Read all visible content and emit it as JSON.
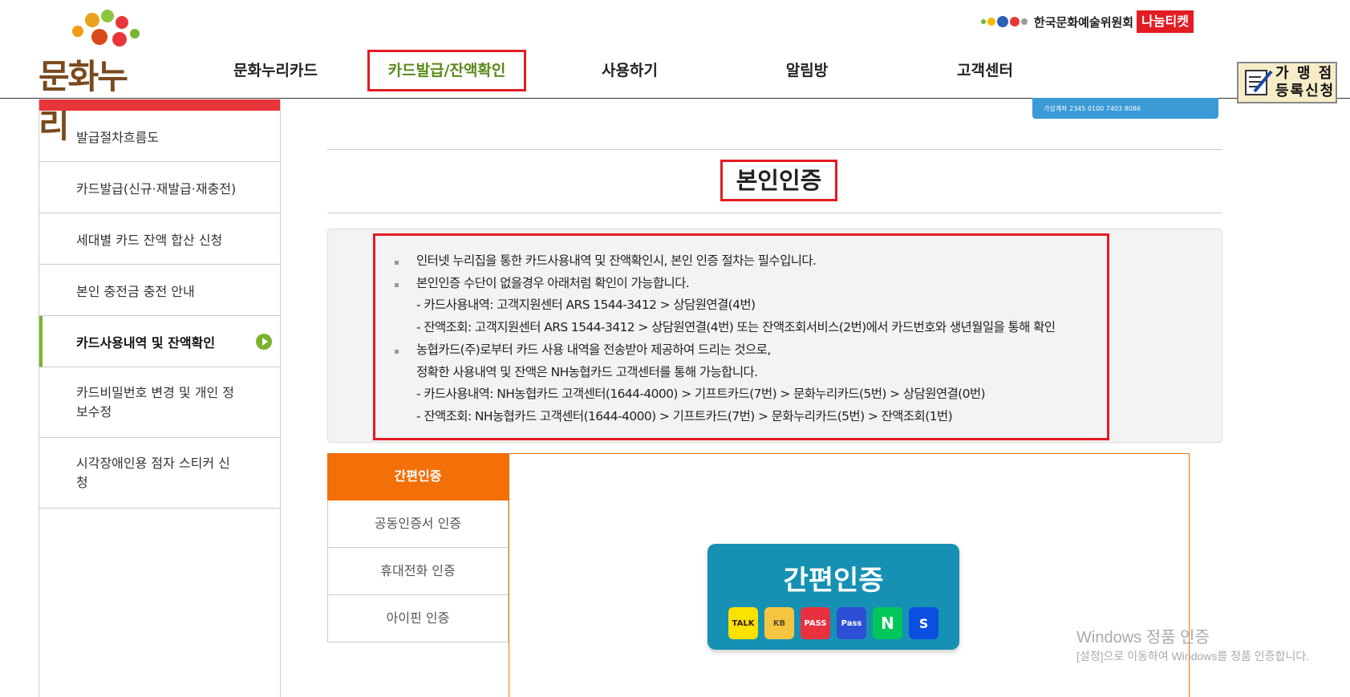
{
  "header": {
    "logo_text": "문화누리",
    "nav": [
      {
        "label": "문화누리카드",
        "active": false
      },
      {
        "label": "카드발급/잔액확인",
        "active": true
      },
      {
        "label": "사용하기",
        "active": false
      },
      {
        "label": "알림방",
        "active": false
      },
      {
        "label": "고객센터",
        "active": false
      }
    ],
    "arko_label": "한국문화예술위원회",
    "nanum_label": "나눔티켓",
    "store_button": {
      "line1": "가 맹 점",
      "line2": "등록신청"
    },
    "banner_text": "가상계좌 2345 0100 7403 8086"
  },
  "sidebar": {
    "items": [
      {
        "label": "발급절차흐름도",
        "active": false
      },
      {
        "label": "카드발급(신규·재발급·재충전)",
        "active": false
      },
      {
        "label": "세대별 카드 잔액 합산 신청",
        "active": false
      },
      {
        "label": "본인 충전금 충전 안내",
        "active": false
      },
      {
        "label": "카드사용내역 및 잔액확인",
        "active": true
      },
      {
        "label": "카드비밀번호 변경 및 개인 정보수정",
        "active": false
      },
      {
        "label": "시각장애인용 점자 스티커 신청",
        "active": false
      }
    ]
  },
  "main": {
    "title": "본인인증",
    "notice": [
      {
        "text": "인터넷 누리집을 통한 카드사용내역 및 잔액확인시, 본인 인증 절차는 필수입니다.",
        "bullet": true
      },
      {
        "text": "본인인증 수단이 없을경우 아래처럼 확인이 가능합니다.",
        "bullet": true
      },
      {
        "text": "- 카드사용내역: 고객지원센터 ARS 1544-3412 > 상담원연결(4번)",
        "bullet": false
      },
      {
        "text": "- 잔액조회: 고객지원센터 ARS 1544-3412 > 상담원연결(4번) 또는 잔액조회서비스(2번)에서 카드번호와 생년월일을 통해 확인",
        "bullet": false
      },
      {
        "text": "농협카드(주)로부터 카드 사용 내역을 전송받아 제공하여 드리는 것으로,",
        "bullet": true
      },
      {
        "text": "정확한 사용내역 및 잔액은 NH농협카드 고객센터를 통해 가능합니다.",
        "bullet": false
      },
      {
        "text": "- 카드사용내역: NH농협카드 고객센터(1644-4000) > 기프트카드(7번) > 문화누리카드(5번) > 상담원연결(0번)",
        "bullet": false
      },
      {
        "text": "- 잔액조회: NH농협카드 고객센터(1644-4000) > 기프트카드(7번) > 문화누리카드(5번) > 잔액조회(1번)",
        "bullet": false
      }
    ],
    "auth_tabs": [
      {
        "label": "간편인증",
        "active": true
      },
      {
        "label": "공동인증서 인증",
        "active": false
      },
      {
        "label": "휴대전화 인증",
        "active": false
      },
      {
        "label": "아이핀 인증",
        "active": false
      }
    ],
    "simple_auth_label": "간편인증",
    "providers": [
      {
        "name": "kakao",
        "label": "TALK",
        "bg": "#fae100",
        "fg": "#3a1d1d"
      },
      {
        "name": "kb",
        "label": "KB",
        "bg": "#f5c542",
        "fg": "#5a4a2a"
      },
      {
        "name": "pass-red",
        "label": "PASS",
        "bg": "#e8303f",
        "fg": "#ffffff"
      },
      {
        "name": "pass-blue",
        "label": "Pass",
        "bg": "#2d4fd6",
        "fg": "#ffffff"
      },
      {
        "name": "naver",
        "label": "N",
        "bg": "#03c75a",
        "fg": "#ffffff"
      },
      {
        "name": "shinhan",
        "label": "S",
        "bg": "#0a4fe0",
        "fg": "#ffffff"
      }
    ]
  },
  "watermark": {
    "line1": "Windows 정품 인증",
    "line2": "[설정]으로 이동하여 Windows를 정품 인증합니다."
  }
}
